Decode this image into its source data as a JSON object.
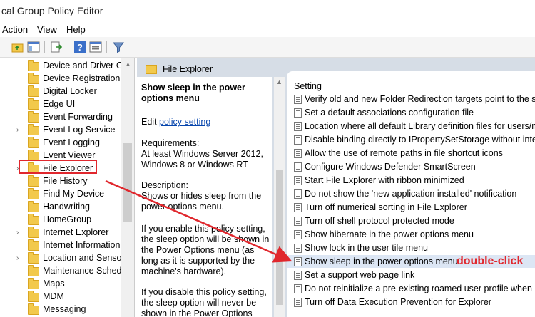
{
  "window": {
    "title": "cal Group Policy Editor"
  },
  "menu": [
    "Action",
    "View",
    "Help"
  ],
  "tree": {
    "items": [
      {
        "label": "Device and Driver Co",
        "expandable": false
      },
      {
        "label": "Device Registration",
        "expandable": false
      },
      {
        "label": "Digital Locker",
        "expandable": false
      },
      {
        "label": "Edge UI",
        "expandable": false
      },
      {
        "label": "Event Forwarding",
        "expandable": false
      },
      {
        "label": "Event Log Service",
        "expandable": true
      },
      {
        "label": "Event Logging",
        "expandable": false
      },
      {
        "label": "Event Viewer",
        "expandable": false
      },
      {
        "label": "File Explorer",
        "expandable": true,
        "selected": true
      },
      {
        "label": "File History",
        "expandable": false
      },
      {
        "label": "Find My Device",
        "expandable": false
      },
      {
        "label": "Handwriting",
        "expandable": false
      },
      {
        "label": "HomeGroup",
        "expandable": false
      },
      {
        "label": "Internet Explorer",
        "expandable": true
      },
      {
        "label": "Internet Information",
        "expandable": false
      },
      {
        "label": "Location and Sensors",
        "expandable": true
      },
      {
        "label": "Maintenance Schedu",
        "expandable": false
      },
      {
        "label": "Maps",
        "expandable": false
      },
      {
        "label": "MDM",
        "expandable": false
      },
      {
        "label": "Messaging",
        "expandable": false
      }
    ]
  },
  "header": {
    "title": "File Explorer"
  },
  "description": {
    "title": "Show sleep in the power options menu",
    "edit_prefix": "Edit ",
    "edit_link": "policy setting",
    "requirements": "Requirements:",
    "req_text": "At least Windows Server 2012, Windows 8 or Windows RT",
    "desc_label": "Description:",
    "desc_text": "Shows or hides sleep from the power options menu.",
    "enable_text": "If you enable this policy setting, the sleep option will be shown in the Power Options menu (as long as it is supported by the machine's hardware).",
    "disable_text": "If you disable this policy setting, the sleep option will never be shown in the Power Options"
  },
  "list": {
    "column": "Setting",
    "selected_index": 13,
    "items": [
      "Verify old and new Folder Redirection targets point to the sa",
      "Set a default associations configuration file",
      "Location where all default Library definition files for users/m",
      "Disable binding directly to IPropertySetStorage without inter",
      "Allow the use of remote paths in file shortcut icons",
      "Configure Windows Defender SmartScreen",
      "Start File Explorer with ribbon minimized",
      "Do not show the 'new application installed' notification",
      "Turn off numerical sorting in File Explorer",
      "Turn off shell protocol protected mode",
      "Show hibernate in the power options menu",
      "Show lock in the user tile menu",
      "Show sleep in the power options menu",
      "Set a support web page link",
      "Do not reinitialize a pre-existing roamed user profile when it",
      "Turn off Data Execution Prevention for Explorer"
    ]
  },
  "annotation": {
    "label": "double-click",
    "color": "#e0272d"
  }
}
